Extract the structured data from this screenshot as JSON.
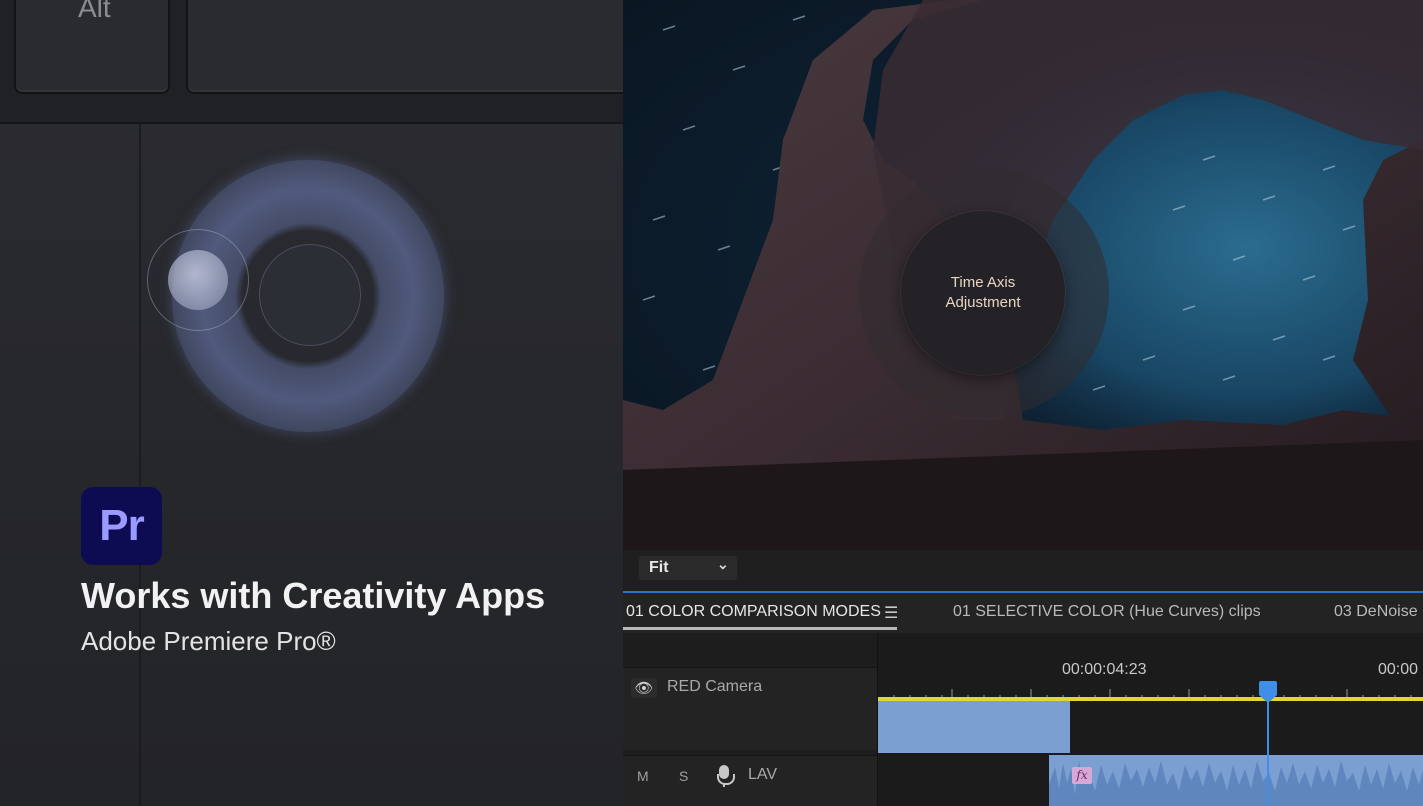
{
  "keyboard": {
    "alt_key_label": "Alt"
  },
  "promo": {
    "logo_text": "Pr",
    "headline": "Works with Creativity Apps",
    "subline": "Adobe Premiere Pro®"
  },
  "viewer": {
    "dial_label_line1": "Time Axis",
    "dial_label_line2": "Adjustment",
    "zoom_select": "Fit"
  },
  "tabs": [
    {
      "label": "01 COLOR COMPARISON MODES",
      "active": true
    },
    {
      "label": "01 SELECTIVE COLOR (Hue Curves) clips",
      "active": false
    },
    {
      "label": "03 DeNoise",
      "active": false
    }
  ],
  "timeline": {
    "timecode_current": "00:00:04:23",
    "timecode_next": "00:00",
    "video_track": {
      "name": "RED Camera"
    },
    "audio_track": {
      "mute": "M",
      "solo": "S",
      "name": "LAV",
      "effect_badge": "fx"
    }
  },
  "colors": {
    "accent_blue": "#3f8ee8",
    "clip_blue": "#7a9fd0",
    "work_area_yellow": "#e6d33a",
    "premiere_logo_bg": "#0d0c52",
    "premiere_logo_fg": "#9b9bff"
  },
  "icons": [
    "eye-icon",
    "menu-icon",
    "chevron-down-icon",
    "microphone-icon",
    "fx-icon"
  ]
}
